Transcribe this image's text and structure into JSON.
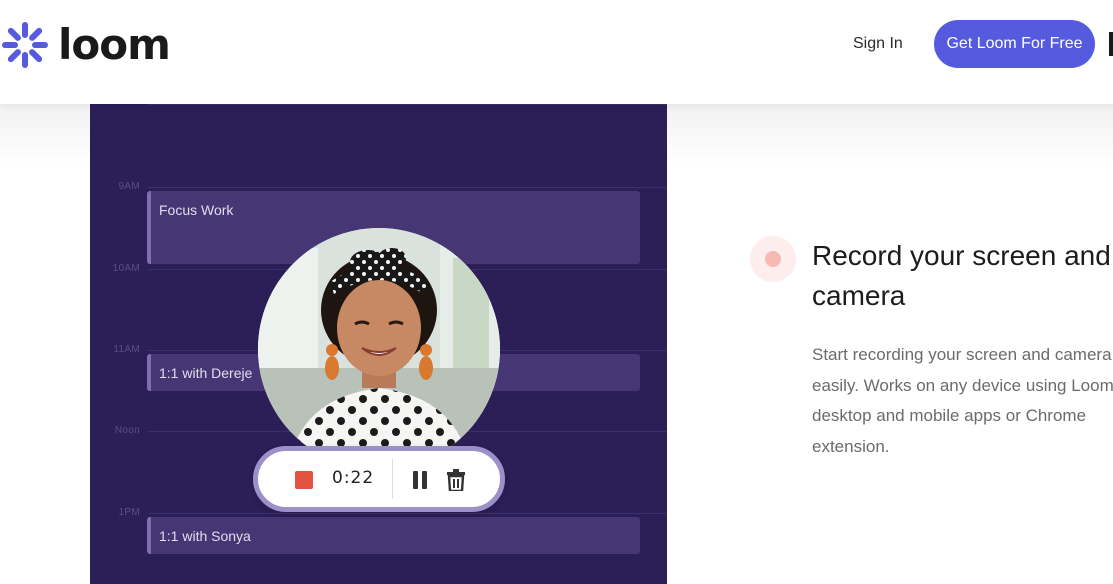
{
  "header": {
    "logo_text": "loom",
    "sign_in": "Sign In",
    "cta": "Get Loom For Free",
    "brand_color": "#565adf"
  },
  "calendar": {
    "times": [
      "9AM",
      "10AM",
      "11AM",
      "Noon",
      "1PM"
    ],
    "events": [
      {
        "label": "Focus Work"
      },
      {
        "label": "1:1 with Dereje"
      },
      {
        "label": "1:1 with Sonya"
      }
    ]
  },
  "recorder": {
    "timer": "0:22",
    "stop_color": "#e3513f"
  },
  "feature": {
    "title": "Record your screen and camera",
    "description": "Start recording your screen and camera easily. Works on any device using Loom’s desktop and mobile apps or Chrome extension."
  }
}
